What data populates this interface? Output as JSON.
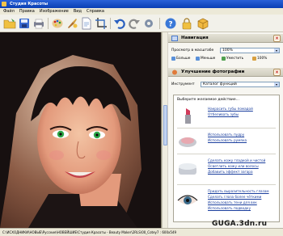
{
  "window": {
    "title": "Студия Красоты"
  },
  "menu": [
    "Файл",
    "Правка",
    "Изображение",
    "Вид",
    "Справка"
  ],
  "toolbar": {
    "icons": [
      "open-folder-icon",
      "save-icon",
      "print-icon",
      "palette-icon",
      "brush-icon",
      "document-icon",
      "crop-icon",
      "undo-icon",
      "redo-icon",
      "settings-icon",
      "help-icon",
      "lock-icon",
      "box-icon"
    ]
  },
  "navigation": {
    "title": "Навигация",
    "zoom_label": "Просмотр в масштабе",
    "zoom_value": "100%",
    "buttons": {
      "bigger": "Больше",
      "smaller": "Меньше",
      "fit": "Уместить",
      "actual": "100%"
    }
  },
  "enhance": {
    "title": "Улучшение фотографии",
    "tool_label": "Инструмент",
    "tool_value": "Каталог функций",
    "catalog_title": "Выберите желаемое действие...",
    "groups": [
      {
        "icon": "lipstick-icon",
        "links": [
          "Накрасить губы помадой",
          "Отбеливать зубы"
        ]
      },
      {
        "icon": "powder-icon",
        "links": [
          "Использовать пудру",
          "Использовать румяна"
        ]
      },
      {
        "icon": "cream-icon",
        "links": [
          "Сделать кожу гладкой и чистой",
          "Осветлить кожу или волосы",
          "Добавить эффект загара"
        ]
      },
      {
        "icon": "eye-icon",
        "links": [
          "Придать выразительность глазам",
          "Сделать глаза более чёткими",
          "Использовать тени для век",
          "Использовать подводку"
        ]
      }
    ]
  },
  "status": "C:\\ИСХОДНИКИ\\НОВЫЕ\\Русские\\НОВЕЙШИЕ\\Студия Красоты - Beauty Maker\\2RLS\\00_Сotey7 : 600x549",
  "watermark": "GUGA.3dn.ru"
}
